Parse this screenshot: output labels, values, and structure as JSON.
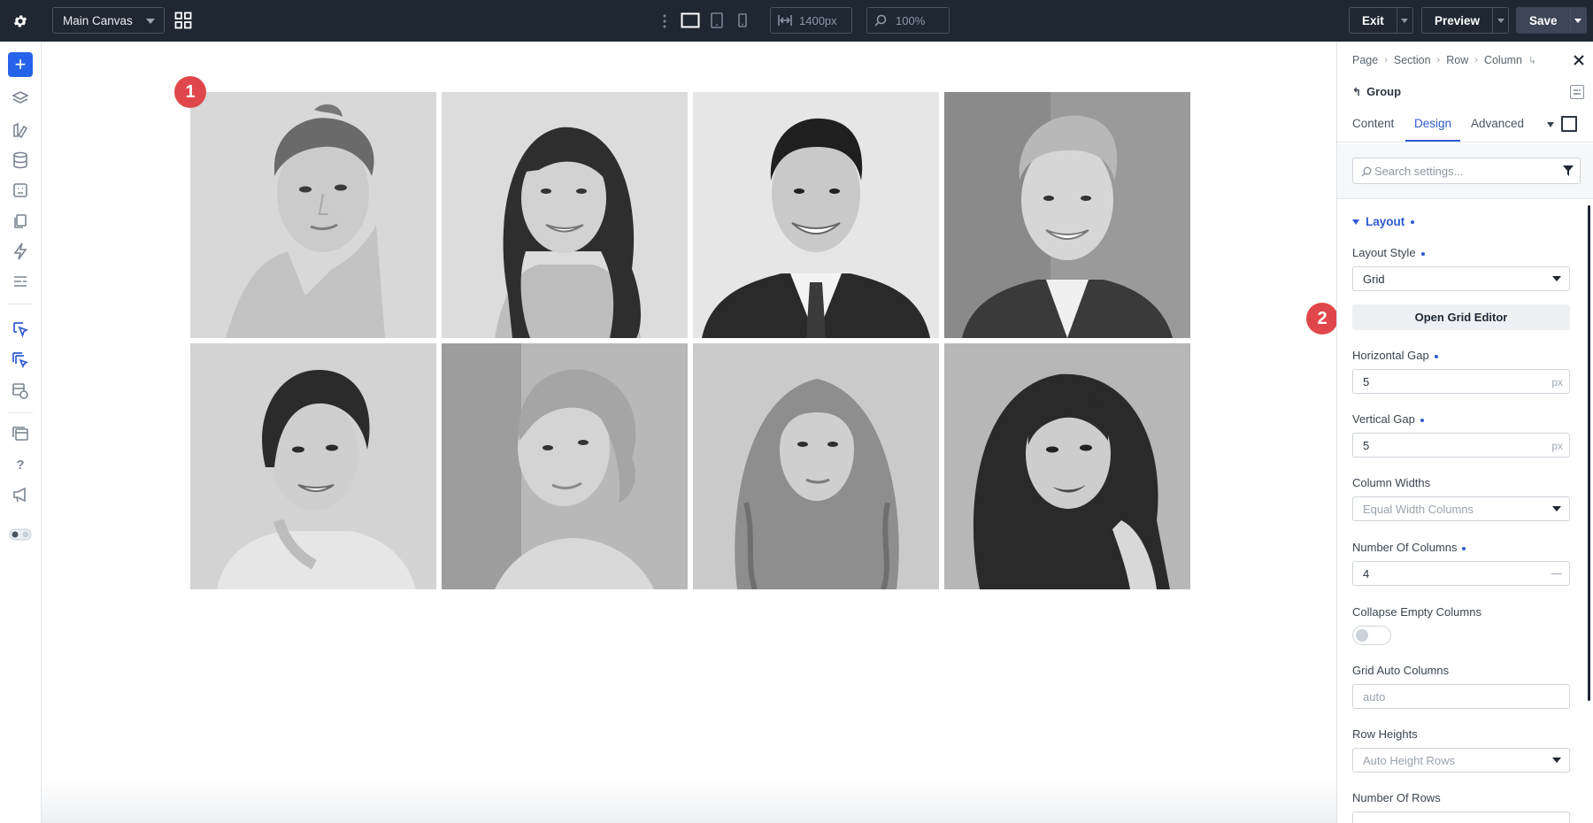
{
  "topbar": {
    "canvas_select": "Main Canvas",
    "width_value": "1400px",
    "zoom_value": "100%",
    "exit_label": "Exit",
    "preview_label": "Preview",
    "save_label": "Save"
  },
  "sidebar": {
    "icons": [
      "add-icon",
      "layers-icon",
      "brush-icon",
      "database-icon",
      "layout-icon",
      "pages-icon",
      "bolt-icon",
      "list-icon",
      "pointer-icon",
      "pointer-multi-icon",
      "theme-icon",
      "windows-icon",
      "help-icon",
      "megaphone-icon",
      "toggle-icon"
    ]
  },
  "canvas": {
    "markers": [
      "1",
      "2"
    ],
    "photos": [
      {
        "name": "photo-woman-updo",
        "bg": "#d6d6d6"
      },
      {
        "name": "photo-woman-long-hair",
        "bg": "#dadada"
      },
      {
        "name": "photo-man-suit",
        "bg": "#e4e4e4"
      },
      {
        "name": "photo-man-blond",
        "bg": "#9e9e9e"
      },
      {
        "name": "photo-woman-bride",
        "bg": "#cfcfcf"
      },
      {
        "name": "photo-woman-over-shoulder",
        "bg": "#bdbdbd"
      },
      {
        "name": "photo-woman-wavy",
        "bg": "#c8c8c8"
      },
      {
        "name": "photo-woman-hand-neck",
        "bg": "#b5b5b5"
      }
    ]
  },
  "panel": {
    "breadcrumb": [
      "Page",
      "Section",
      "Row",
      "Column"
    ],
    "group_title": "Group",
    "tabs": [
      "Content",
      "Design",
      "Advanced"
    ],
    "active_tab": "Design",
    "search_placeholder": "Search settings...",
    "section_title": "Layout",
    "fields": {
      "layout_style_label": "Layout Style",
      "layout_style_value": "Grid",
      "grid_editor_button": "Open Grid Editor",
      "horizontal_gap_label": "Horizontal Gap",
      "horizontal_gap_value": "5",
      "vertical_gap_label": "Vertical Gap",
      "vertical_gap_value": "5",
      "unit": "px",
      "column_widths_label": "Column Widths",
      "column_widths_value": "Equal Width Columns",
      "num_columns_label": "Number Of Columns",
      "num_columns_value": "4",
      "collapse_empty_label": "Collapse Empty Columns",
      "collapse_empty_on": false,
      "grid_auto_columns_label": "Grid Auto Columns",
      "grid_auto_columns_placeholder": "auto",
      "row_heights_label": "Row Heights",
      "row_heights_value": "Auto Height Rows",
      "num_rows_label": "Number Of Rows"
    }
  },
  "colors": {
    "topbar_bg": "#1f2733",
    "accent": "#2f5bd3",
    "add_button": "#2563eb",
    "marker": "#e0474c"
  }
}
